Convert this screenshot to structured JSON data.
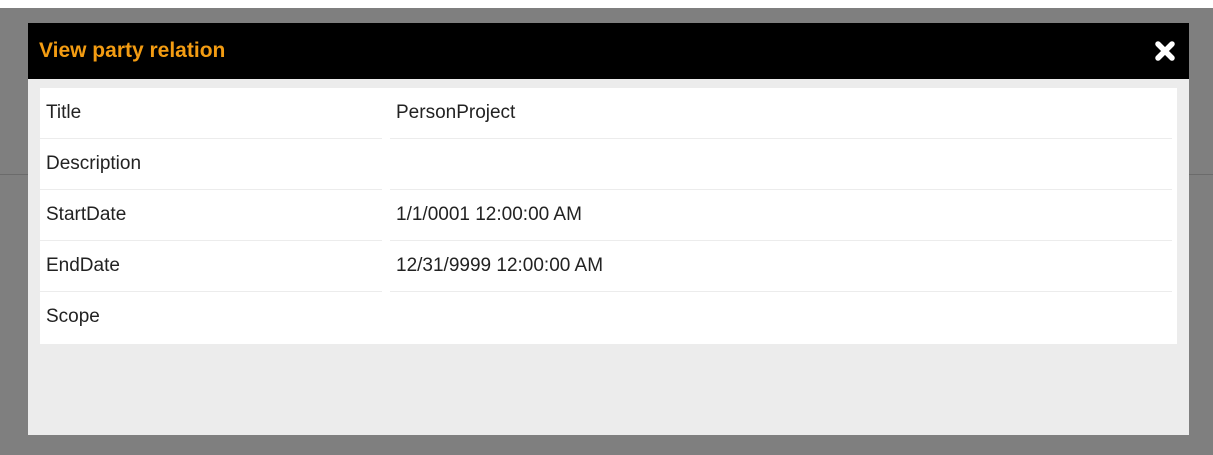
{
  "dialog": {
    "title": "View party relation",
    "close_icon": "close-icon"
  },
  "colors": {
    "title_text": "#f39c12",
    "titlebar_bg": "#000000",
    "dialog_bg": "#ececec",
    "overlay": "#7f7f7f"
  },
  "details": {
    "rows": [
      {
        "label": "Title",
        "value": "PersonProject"
      },
      {
        "label": "Description",
        "value": ""
      },
      {
        "label": "StartDate",
        "value": "1/1/0001 12:00:00 AM"
      },
      {
        "label": "EndDate",
        "value": "12/31/9999 12:00:00 AM"
      },
      {
        "label": "Scope",
        "value": ""
      }
    ]
  }
}
